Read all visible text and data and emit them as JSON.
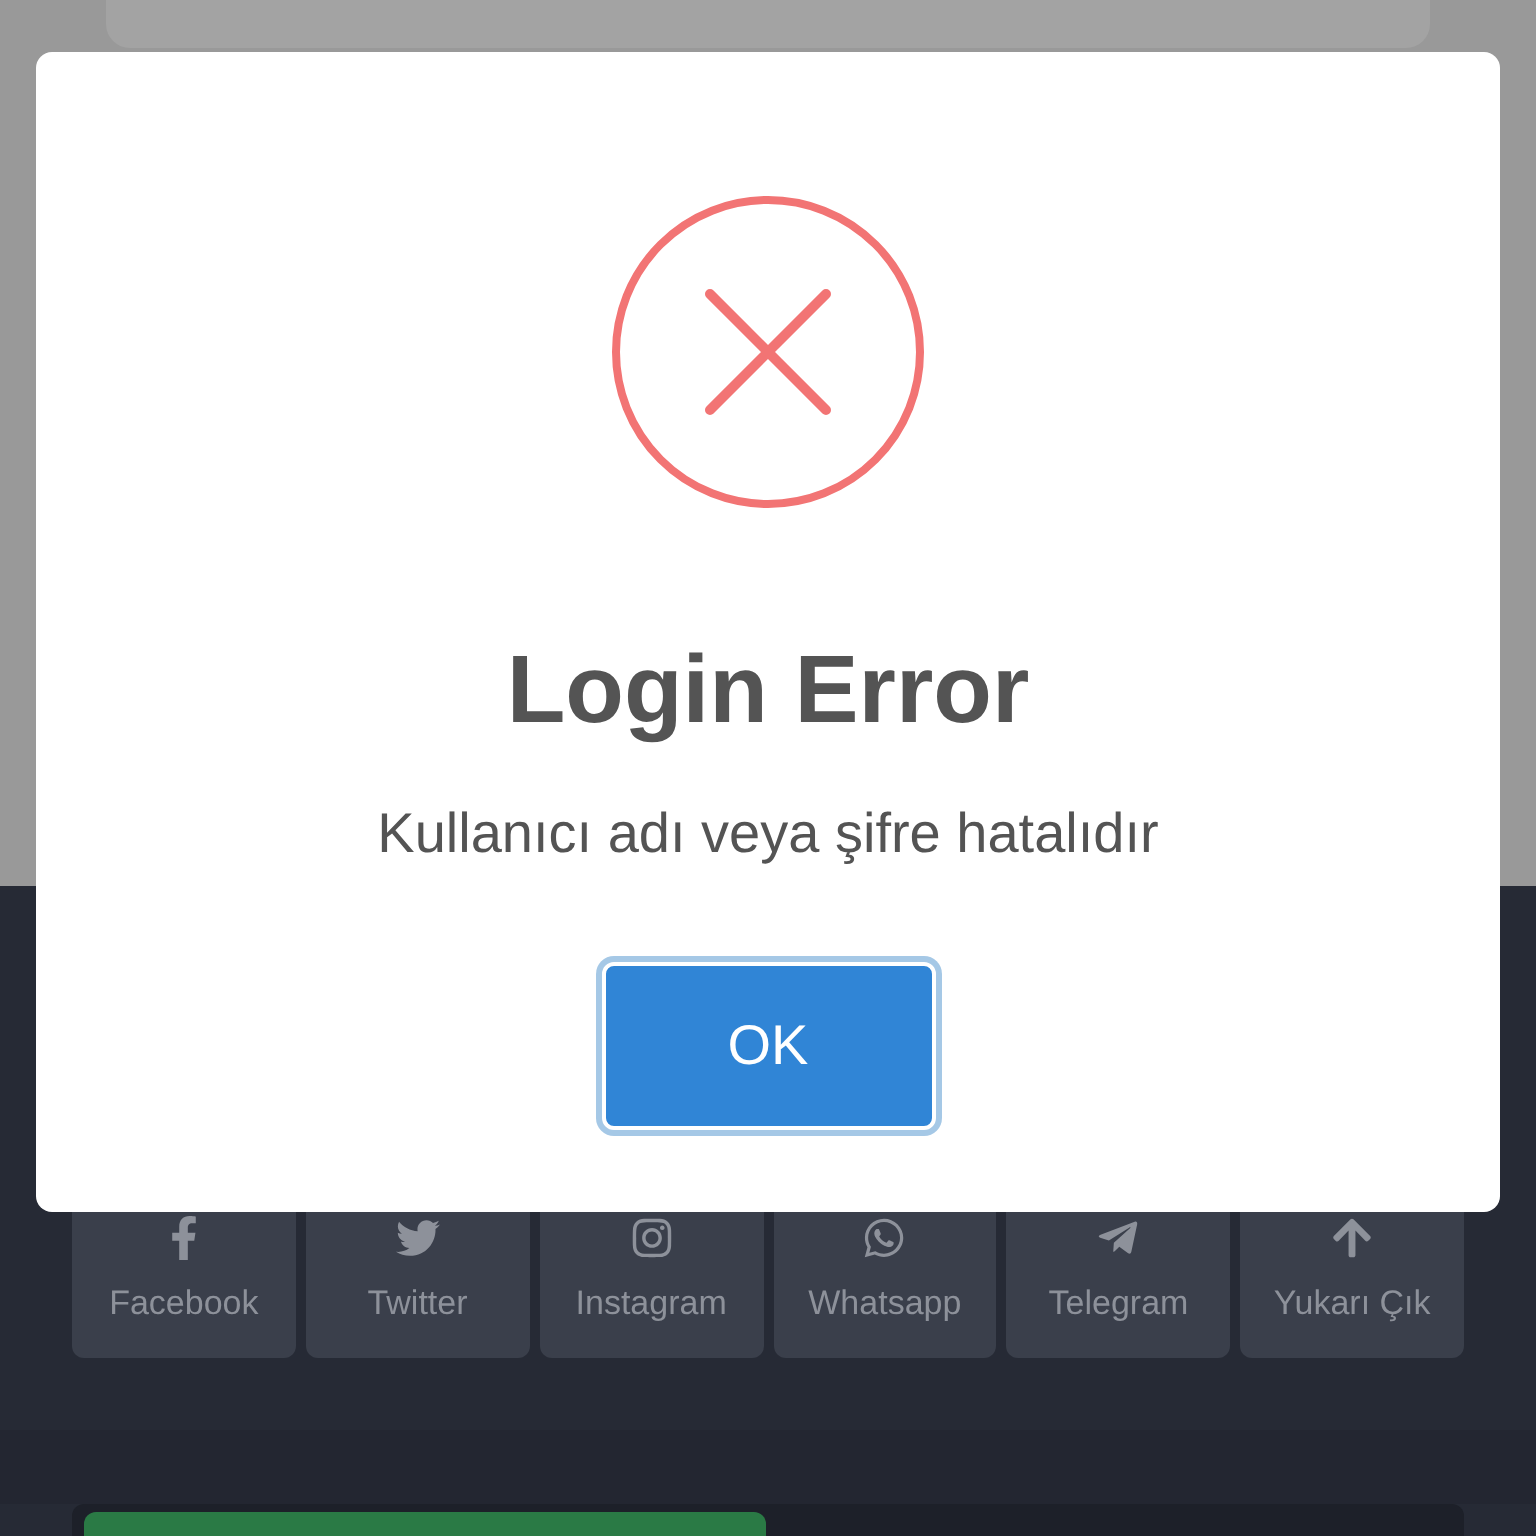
{
  "dialog": {
    "title": "Login Error",
    "message": "Kullanıcı adı veya şifre hatalıdır",
    "button": "OK"
  },
  "social_links": [
    {
      "kind": "facebook",
      "label": "Facebook"
    },
    {
      "kind": "twitter",
      "label": "Twitter"
    },
    {
      "kind": "instagram",
      "label": "Instagram"
    },
    {
      "kind": "whatsapp",
      "label": "Whatsapp"
    },
    {
      "kind": "telegram",
      "label": "Telegram"
    },
    {
      "kind": "top",
      "label": "Yukarı Çık"
    }
  ]
}
